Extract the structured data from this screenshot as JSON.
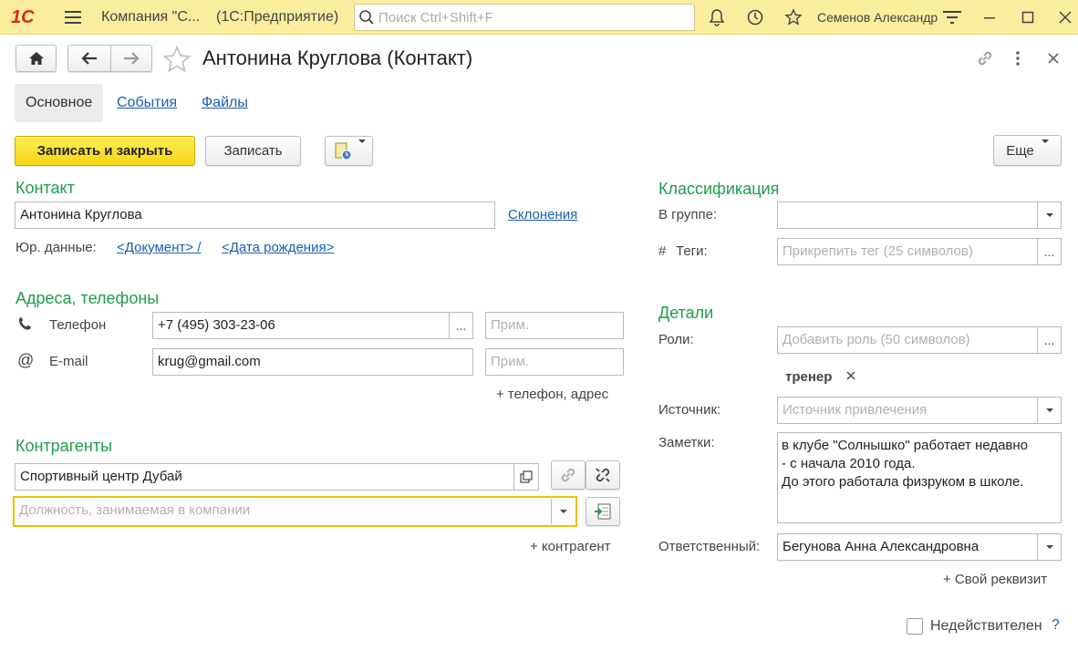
{
  "titlebar": {
    "logo": "1С",
    "company": "Компания \"С...",
    "app": "(1С:Предприятие)",
    "search_placeholder": "Поиск Ctrl+Shift+F",
    "user": "Семенов Александр"
  },
  "form": {
    "title": "Антонина Круглова (Контакт)",
    "tabs": [
      "Основное",
      "События",
      "Файлы"
    ],
    "save_close": "Записать и закрыть",
    "save": "Записать",
    "more": "Еще"
  },
  "contact": {
    "section": "Контакт",
    "name": "Антонина Круглова",
    "declensions": "Склонения",
    "legal_label": "Юр. данные:",
    "document_link": "<Документ> /",
    "birthdate_link": "<Дата рождения>"
  },
  "addresses": {
    "section": "Адреса, телефоны",
    "phone_label": "Телефон",
    "phone_value": "+7 (495) 303-23-06",
    "note_placeholder": "Прим.",
    "email_label": "E-mail",
    "email_value": "krug@gmail.com",
    "add": "+ телефон, адрес"
  },
  "counterparties": {
    "section": "Контрагенты",
    "company": "Спортивный центр Дубай",
    "position_placeholder": "Должность, занимаемая в компании",
    "add": "+ контрагент"
  },
  "classification": {
    "section": "Классификация",
    "group_label": "В группе:",
    "group_value": "",
    "tags_label": "Теги:",
    "tags_hash": "#",
    "tags_placeholder": "Прикрепить тег (25 символов)"
  },
  "details": {
    "section": "Детали",
    "roles_label": "Роли:",
    "roles_placeholder": "Добавить роль (50 символов)",
    "role_tag": "тренер",
    "source_label": "Источник:",
    "source_placeholder": "Источник привлечения",
    "notes_label": "Заметки:",
    "notes_lines": [
      "в клубе \"Солнышко\" работает недавно",
      "- с начала 2010 года.",
      "До этого работала физруком в школе."
    ],
    "responsible_label": "Ответственный:",
    "responsible_value": "Бегунова Анна Александровна",
    "add_attr": "+ Свой реквизит",
    "inactive_label": "Недействителен",
    "help": "?"
  },
  "colors": {
    "accent": "#1e9e4a",
    "link": "#1a5eb5",
    "titlebar": "#fbed9e",
    "primary_button": "#f7d517"
  }
}
